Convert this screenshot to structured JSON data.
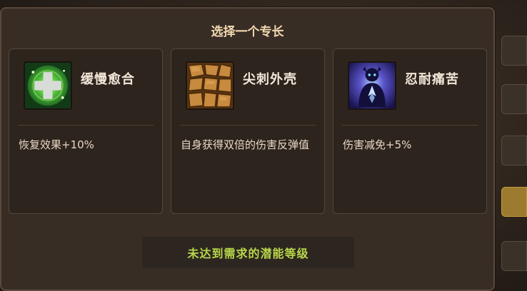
{
  "modal": {
    "title": "选择一个专长",
    "notice": "未达到需求的潜能等级"
  },
  "perks": [
    {
      "name": "缓慢愈合",
      "description": "恢复效果+10%",
      "icon": "healing-cross-icon"
    },
    {
      "name": "尖刺外壳",
      "description": "自身获得双倍的伤害反弹值",
      "icon": "spiked-shell-icon"
    },
    {
      "name": "忍耐痛苦",
      "description": "伤害减免+5%",
      "icon": "endure-pain-icon"
    }
  ],
  "colors": {
    "modal_bg": "#382d25",
    "card_bg": "#2e241e",
    "title": "#f1d8b0",
    "notice": "#b7d64a"
  }
}
